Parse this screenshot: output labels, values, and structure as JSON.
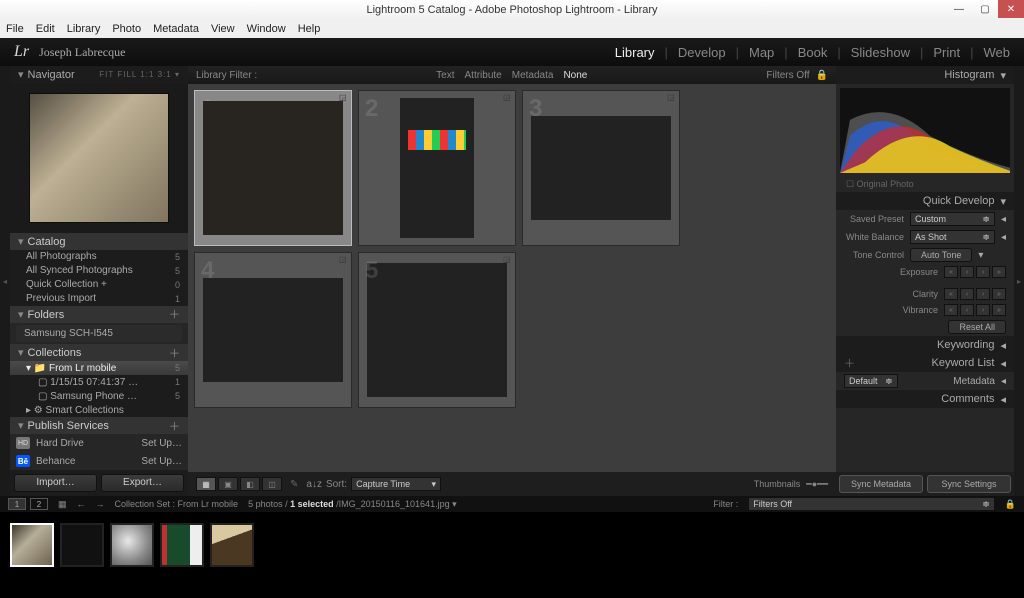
{
  "window": {
    "title": "Lightroom 5 Catalog - Adobe Photoshop Lightroom - Library"
  },
  "menubar": [
    "File",
    "Edit",
    "Library",
    "Photo",
    "Metadata",
    "View",
    "Window",
    "Help"
  ],
  "identity": {
    "logo": "Lr",
    "user": "Joseph Labrecque"
  },
  "modules": [
    "Library",
    "Develop",
    "Map",
    "Book",
    "Slideshow",
    "Print",
    "Web"
  ],
  "active_module": "Library",
  "left": {
    "navigator": {
      "title": "Navigator",
      "modes": "FIT  FILL  1:1   3:1 ▾"
    },
    "catalog": {
      "title": "Catalog",
      "items": [
        {
          "label": "All Photographs",
          "count": "5"
        },
        {
          "label": "All Synced Photographs",
          "count": "5"
        },
        {
          "label": "Quick Collection  +",
          "count": "0"
        },
        {
          "label": "Previous Import",
          "count": "1"
        }
      ]
    },
    "folders": {
      "title": "Folders",
      "drive": "Samsung SCH-I545"
    },
    "collections": {
      "title": "Collections",
      "items": [
        {
          "label": "From Lr mobile",
          "count": "5",
          "selected": true
        },
        {
          "label": "1/15/15 07:41:37 …",
          "count": "1",
          "indent": true
        },
        {
          "label": "Samsung Phone …",
          "count": "5",
          "indent": true
        },
        {
          "label": "Smart Collections",
          "count": "",
          "indent": false
        }
      ]
    },
    "publish": {
      "title": "Publish Services",
      "services": [
        {
          "icon": "hd",
          "name": "Hard Drive",
          "action": "Set Up…"
        },
        {
          "icon": "be",
          "name": "Behance",
          "action": "Set Up…"
        }
      ]
    },
    "buttons": {
      "import": "Import…",
      "export": "Export…"
    }
  },
  "center": {
    "filter_label": "Library Filter :",
    "filter_tabs": [
      "Text",
      "Attribute",
      "Metadata",
      "None"
    ],
    "filter_active": "None",
    "filters_off": "Filters Off",
    "sort_label": "Sort:",
    "sort_value": "Capture Time",
    "thumbnails_label": "Thumbnails"
  },
  "right": {
    "histogram_title": "Histogram",
    "original_photo": "Original Photo",
    "quick_develop": {
      "title": "Quick Develop",
      "saved_preset_lbl": "Saved Preset",
      "saved_preset_val": "Custom",
      "wb_lbl": "White Balance",
      "wb_val": "As Shot",
      "tone_lbl": "Tone Control",
      "auto_tone": "Auto Tone",
      "exposure": "Exposure",
      "clarity": "Clarity",
      "vibrance": "Vibrance",
      "reset_all": "Reset All"
    },
    "sections": [
      "Keywording",
      "Keyword List",
      "Metadata",
      "Comments"
    ],
    "metadata_preset": "Default",
    "sync_metadata": "Sync Metadata",
    "sync_settings": "Sync Settings"
  },
  "status": {
    "collection_path": "Collection Set : From Lr mobile",
    "photo_count": "5 photos /",
    "selected": "1 selected",
    "filename": "/IMG_20150116_101641.jpg",
    "filter_lbl": "Filter :",
    "filter_val": "Filters Off"
  }
}
